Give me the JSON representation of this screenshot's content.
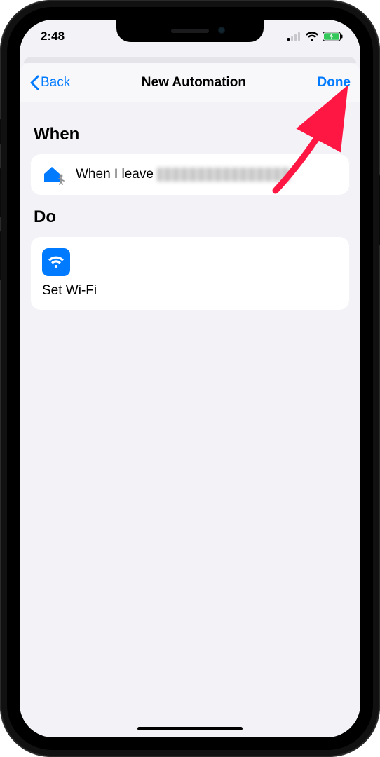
{
  "status": {
    "time": "2:48"
  },
  "navbar": {
    "back_label": "Back",
    "title": "New Automation",
    "done_label": "Done"
  },
  "sections": {
    "when": {
      "heading": "When",
      "trigger_prefix": "When I leave "
    },
    "do": {
      "heading": "Do",
      "action_label": "Set Wi-Fi"
    }
  },
  "colors": {
    "accent": "#007aff"
  }
}
